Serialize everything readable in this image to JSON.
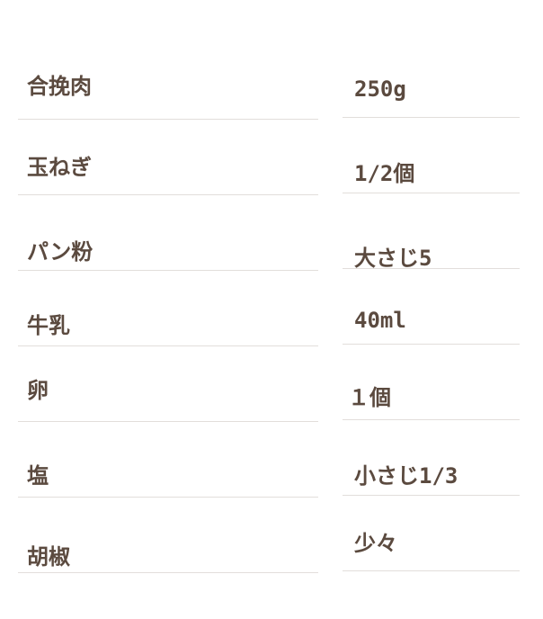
{
  "ingredients": [
    {
      "name": "合挽肉",
      "amount": "250g"
    },
    {
      "name": "玉ねぎ",
      "amount": "1/2個"
    },
    {
      "name": "パン粉",
      "amount": "大さじ5"
    },
    {
      "name": "牛乳",
      "amount": "40ml"
    },
    {
      "name": "卵",
      "amount": "１個"
    },
    {
      "name": "塩",
      "amount": "小さじ1/3"
    },
    {
      "name": "胡椒",
      "amount": "少々"
    }
  ],
  "colors": {
    "text": "#5b4a3f",
    "divider": "#e2dedb",
    "background": "#ffffff"
  }
}
